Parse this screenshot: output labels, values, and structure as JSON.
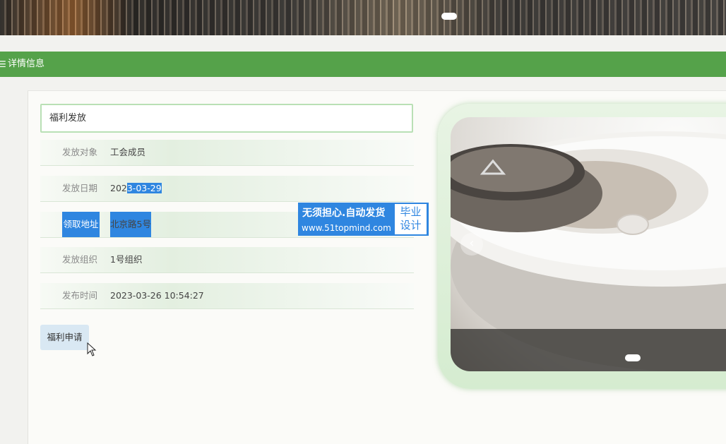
{
  "header": {
    "section_title": "详情信息",
    "menu_icon": "menu-icon"
  },
  "detail": {
    "name": "福利发放",
    "rows": [
      {
        "label": "发放对象",
        "value": "工会成员"
      },
      {
        "label": "发放日期",
        "value_plain": "202",
        "value_selected": "3-03-29"
      },
      {
        "label": "领取地址",
        "value": "北京路5号"
      },
      {
        "label": "发放组织",
        "value": "1号组织"
      },
      {
        "label": "发布时间",
        "value": "2023-03-26 10:54:27"
      }
    ],
    "apply_button": "福利申请"
  },
  "watermark": {
    "line1": "无须担心.自动发货",
    "line2": "www.51topmind.com",
    "side_line1": "毕业",
    "side_line2": "设计"
  },
  "carousel": {
    "prev_label": "‹",
    "slide_index": 1
  },
  "colors": {
    "accent_green": "#55a24a",
    "selection_blue": "#2f86e0",
    "button_bg": "#d9e8f3"
  }
}
